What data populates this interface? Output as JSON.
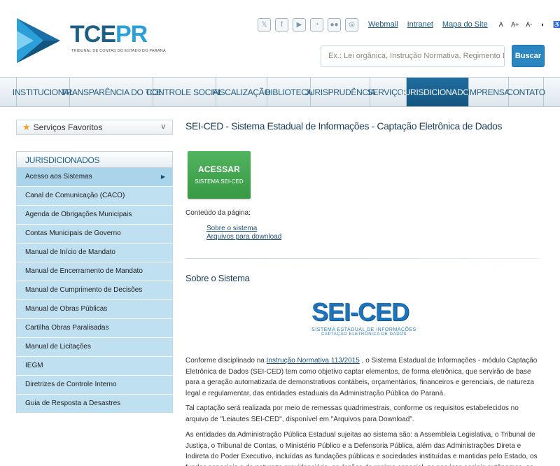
{
  "header": {
    "logo_main": "TCE",
    "logo_accent": "PR",
    "logo_sub": "TRIBUNAL DE CONTAS DO ESTADO DO PARANÁ",
    "social_icons": [
      "x-icon",
      "facebook-icon",
      "youtube-icon",
      "rss-icon",
      "flickr-icon",
      "instagram-icon"
    ],
    "links": [
      "Webmail",
      "Intranet",
      "Mapa do Site"
    ],
    "accessibility": [
      "A",
      "A+",
      "A-",
      "◐",
      "♿"
    ],
    "search_placeholder": "Ex.: Lei orgânica, Instrução Normativa, Regimento Interno",
    "search_button": "Buscar"
  },
  "nav": {
    "items": [
      "INSTITUCIONAL",
      "TRANSPARÊNCIA DO TCE",
      "CONTROLE SOCIAL",
      "FISCALIZAÇÃO",
      "BIBLIOTECA",
      "JURISPRUDÊNCIA",
      "SERVIÇOS",
      "JURISDICIONADOS",
      "IMPRENSA",
      "CONTATO"
    ],
    "active": "JURISDICIONADOS"
  },
  "sidebar": {
    "favorites": "Serviços Favoritos",
    "favorites_chevron": "v",
    "heading": "JURISDICIONADOS",
    "items": [
      "Acesso aos Sistemas",
      "Canal de Comunicação (CACO)",
      "Agenda de Obrigações Municipais",
      "Contas Municipais de Governo",
      "Manual de Início de Mandato",
      "Manual de Encerramento de Mandato",
      "Manual de Cumprimento de Decisões",
      "Manual de Obras Públicas",
      "Cartilha Obras Paralisadas",
      "Manual de Licitações",
      "IEGM",
      "Diretrizes de Controle Interno",
      "Guia de Resposta a Desastres"
    ]
  },
  "content": {
    "title": "SEI-CED - Sistema Estadual de Informações - Captação Eletrônica de Dados",
    "access_button_line1": "ACESSAR",
    "access_button_line2": "SISTEMA SEI-CED",
    "contents_label": "Conteúdo da página:",
    "toc": [
      "Sobre o sistema",
      "Arquivos para download"
    ],
    "section_title": "Sobre o Sistema",
    "logo_main": "SEI-CED",
    "logo_sub1": "SISTEMA ESTADUAL DE INFORMAÇÕES",
    "logo_sub2": "CAPTAÇÃO ELETRÔNICA DE DADOS",
    "p1_before": "Conforme disciplinado na ",
    "p1_link": "Instrução Normativa 113/2015",
    "p1_after": " , o Sistema Estadual de Informações - módulo Captação Eletrônica de Dados (SEI-CED) tem como objetivo captar elementos, de forma eletrônica, que servirão de base para a geração automatizada de demonstrativos contábeis, orçamentários, financeiros e gerenciais, de natureza legal e regulamentar, das entidades estaduais da Administração Pública do Paraná.",
    "p2": "Tal captação será realizada por meio de remessas quadrimestrais, conforme os requisitos estabelecidos no arquivo de \"Leiautes SEI-CED\", disponível em \"Arquivos para Download\".",
    "p3": "As entidades da Administração Pública Estadual sujeitas ao sistema são: a Assembleia Legislativa, o Tribunal de Justiça, o Tribunal de Contas, o Ministério Público e a Defensoria Pública, além das Administrações Direta e Indireta do Poder Executivo, incluídas as fundações públicas e sociedades instituídas e mantidas pelo Estado, os fundos especiais e de natureza previdenciária, os órgãos de regime especial, os serviços sociais autônomos, as empresas"
  }
}
